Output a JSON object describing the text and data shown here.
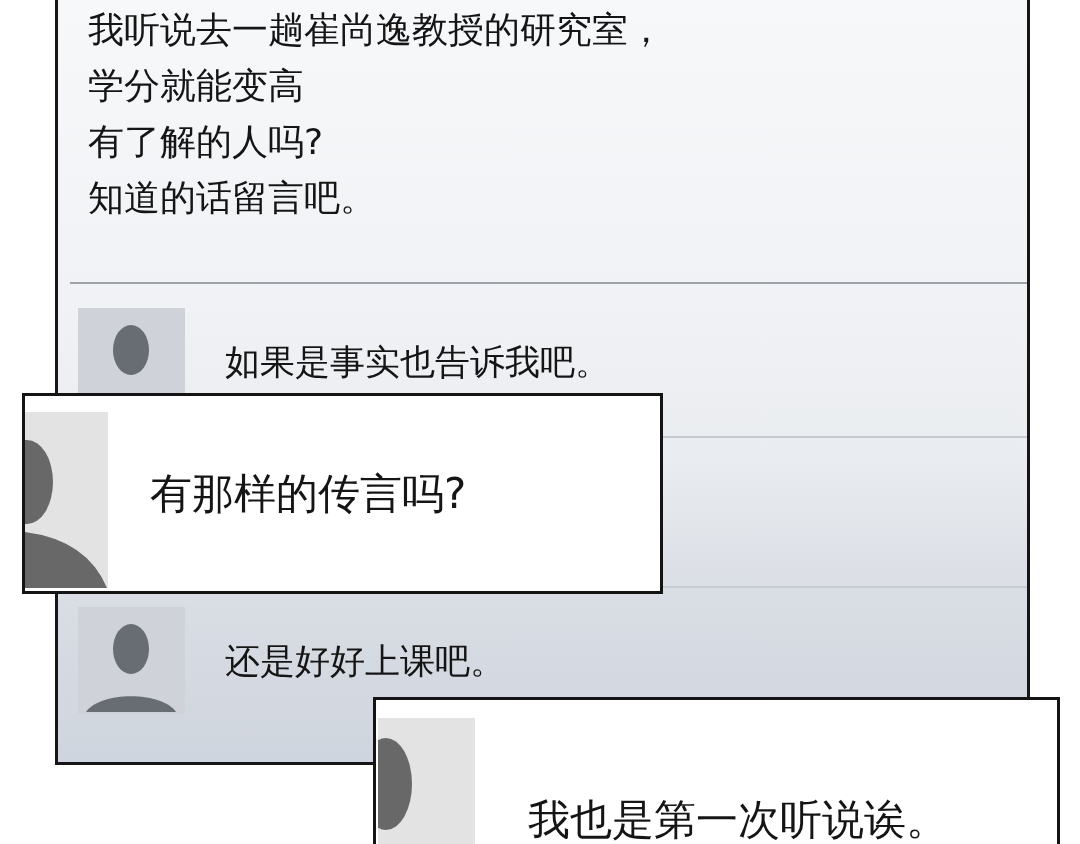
{
  "post": {
    "lines": [
      "我听说去一趟崔尚逸教授的研究室，",
      "学分就能变高",
      "有了解的人吗?",
      "知道的话留言吧。"
    ]
  },
  "comments": [
    {
      "text": "如果是事实也告诉我吧。"
    },
    {
      "text": "还是好好上课吧。"
    }
  ],
  "callouts": [
    {
      "text": "有那样的传言吗?"
    },
    {
      "text": "我也是第一次听说诶。"
    }
  ]
}
